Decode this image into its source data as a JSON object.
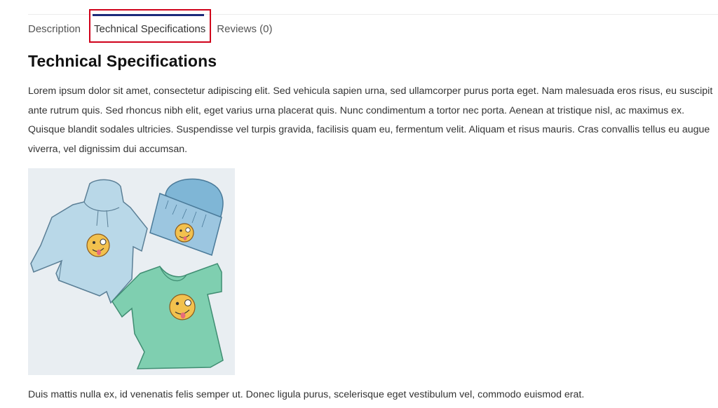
{
  "tabs": [
    {
      "label": "Description",
      "active": false
    },
    {
      "label": "Technical Specifications",
      "active": true
    },
    {
      "label": "Reviews (0)",
      "active": false
    }
  ],
  "section_title": "Technical Specifications",
  "paragraph_1": "Lorem ipsum dolor sit amet, consectetur adipiscing elit. Sed vehicula sapien urna, sed ullamcorper purus porta eget. Nam malesuada eros risus, eu suscipit ante rutrum quis. Sed rhoncus nibh elit, eget varius urna placerat quis. Nunc condimentum a tortor nec porta. Aenean at tristique nisl, ac maximus ex. Quisque blandit sodales ultricies. Suspendisse vel turpis gravida, facilisis quam eu, fermentum velit. Aliquam et risus mauris. Cras convallis tellus eu augue viverra, vel dignissim dui accumsan.",
  "paragraph_2": "Duis mattis nulla ex, id venenatis felis semper ut. Donec ligula purus, scelerisque eget vestibulum vel, commodo euismod erat.",
  "colors": {
    "active_tab_bar": "#1b2a7a",
    "highlight_border": "#d0021b",
    "hoodie": "#b9d8e8",
    "beanie": "#7fb6d6",
    "tshirt": "#7fcfb0",
    "emoji": "#f2c14e"
  },
  "image_icons": [
    "hoodie-icon",
    "beanie-icon",
    "tshirt-icon",
    "winking-emoji-icon"
  ]
}
